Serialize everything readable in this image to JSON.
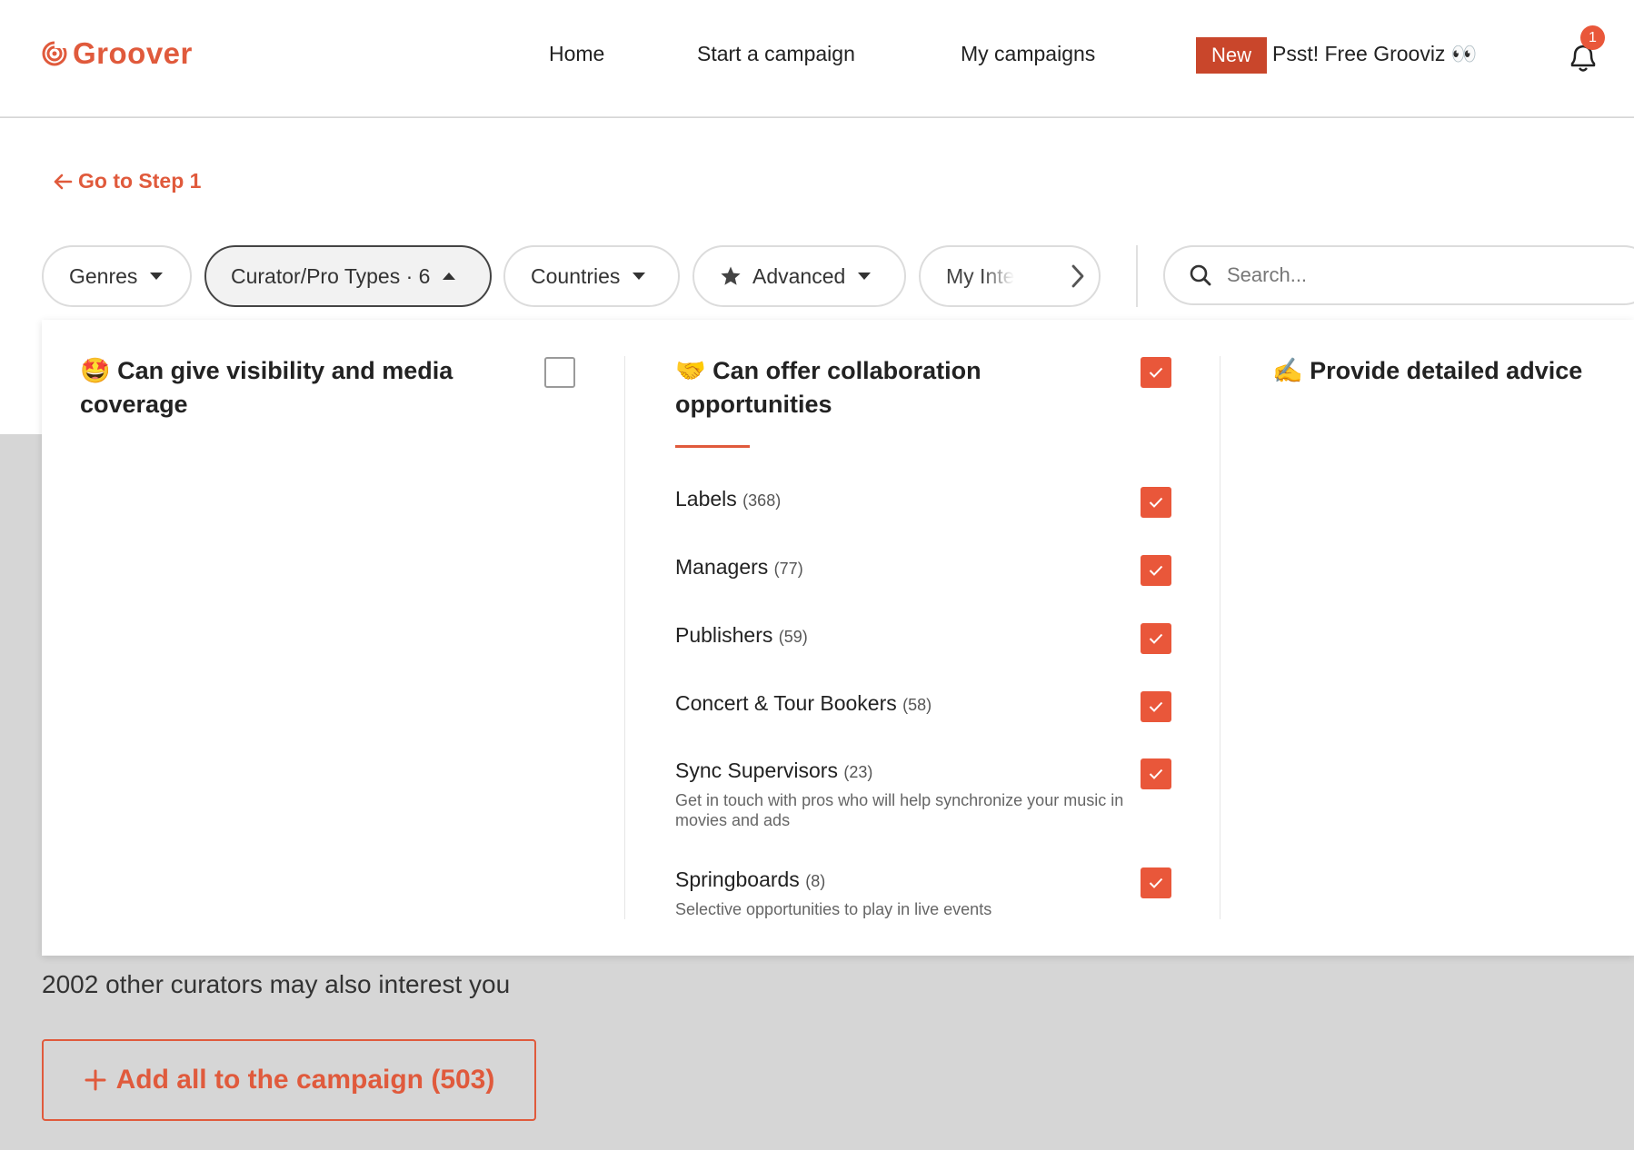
{
  "header": {
    "brand": "Groover",
    "nav": {
      "home": "Home",
      "start": "Start a campaign",
      "my": "My campaigns"
    },
    "new_badge": "New",
    "promo": "Psst! Free Grooviz 👀",
    "notification_count": "1"
  },
  "back_link": "Go to Step 1",
  "filters": {
    "genres": "Genres",
    "types": "Curator/Pro Types · 6",
    "countries": "Countries",
    "advanced": "Advanced",
    "my_interests": "My Inte"
  },
  "search": {
    "placeholder": "Search..."
  },
  "panel": {
    "col1_title": "🤩 Can give visibility and media coverage",
    "col2_title": "🤝 Can offer collaboration opportunities",
    "col3_title": "✍️ Provide detailed advice",
    "items": [
      {
        "label": "Labels",
        "count": "(368)",
        "desc": ""
      },
      {
        "label": "Managers",
        "count": "(77)",
        "desc": ""
      },
      {
        "label": "Publishers",
        "count": "(59)",
        "desc": ""
      },
      {
        "label": "Concert & Tour Bookers",
        "count": "(58)",
        "desc": ""
      },
      {
        "label": "Sync Supervisors",
        "count": "(23)",
        "desc": "Get in touch with pros who will help synchronize your music in movies and ads"
      },
      {
        "label": "Springboards",
        "count": "(8)",
        "desc": "Selective opportunities to play in live events"
      }
    ]
  },
  "other_curators": "2002 other curators may also interest you",
  "add_all": "Add all to the campaign (503)",
  "colors": {
    "accent": "#e05a3c",
    "checkbox": "#e9573a",
    "badge": "#c9462b"
  }
}
